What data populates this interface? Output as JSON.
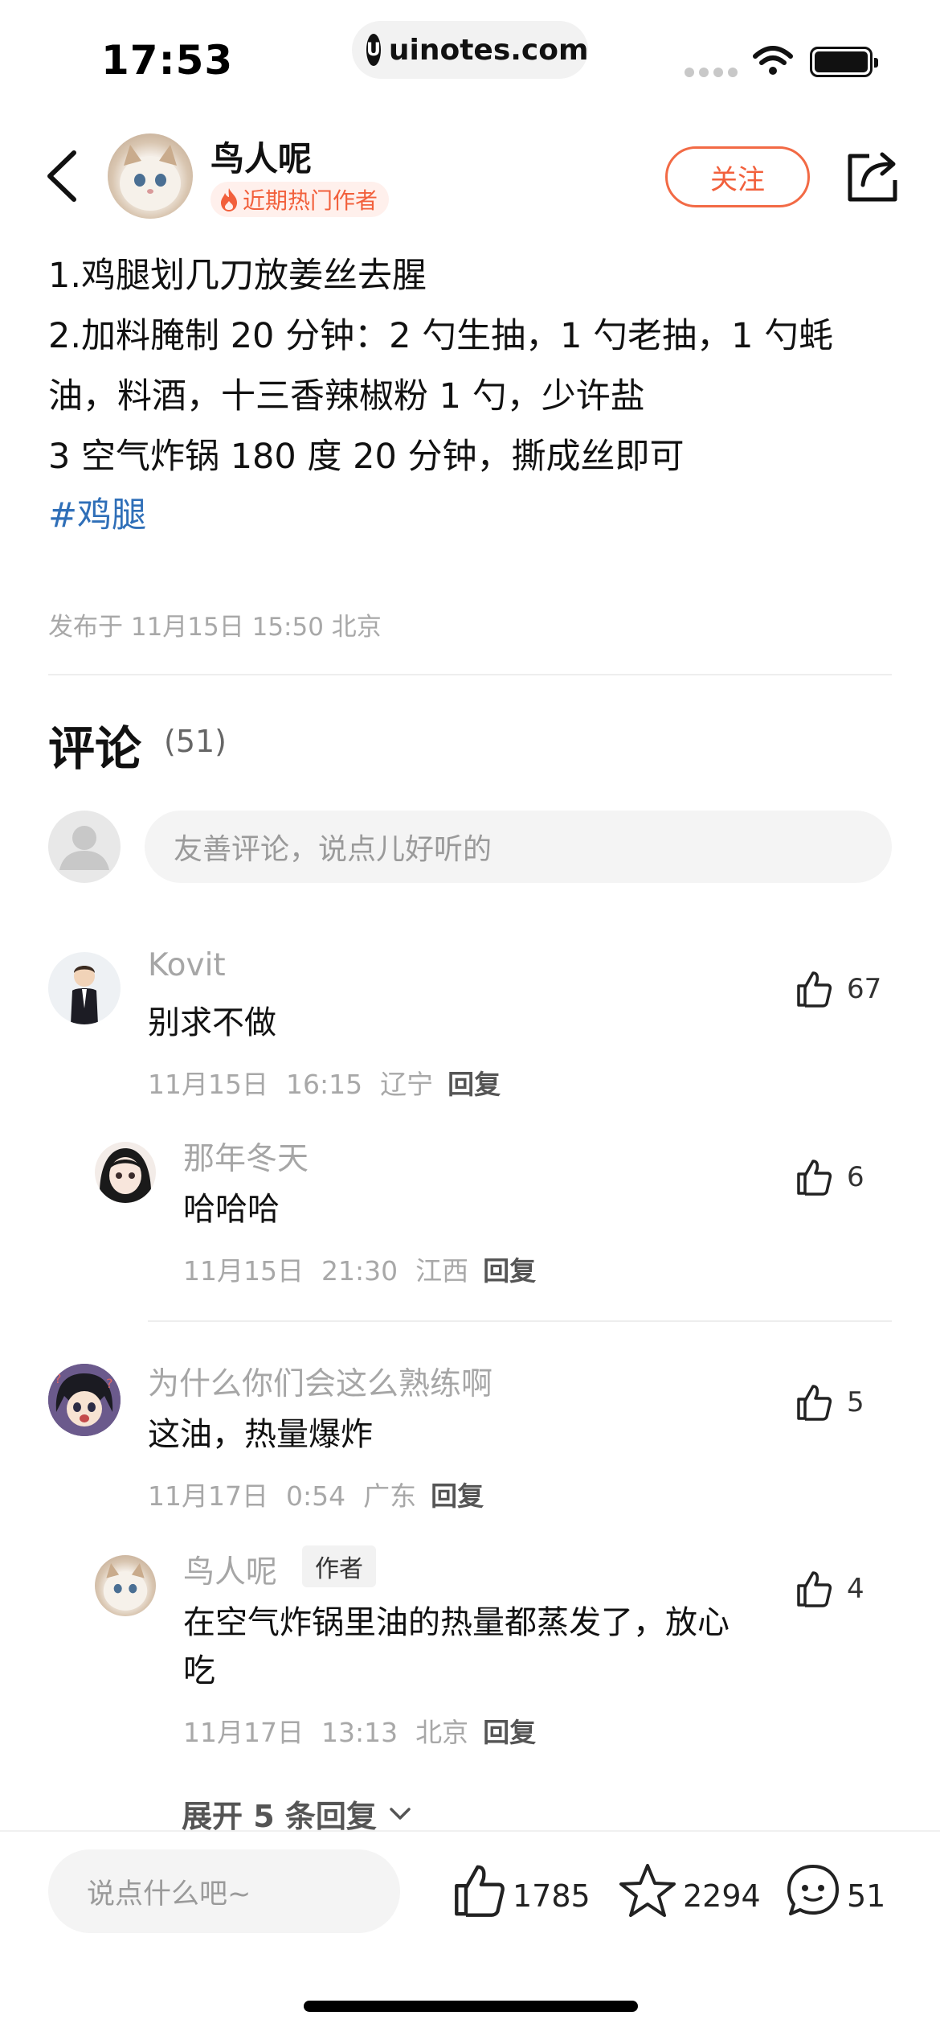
{
  "status_bar": {
    "time": "17:53",
    "url": "uinotes.com"
  },
  "header": {
    "author_name": "鸟人呢",
    "badge_text": "近期热门作者",
    "follow_label": "关注"
  },
  "post": {
    "lines": [
      "1.鸡腿划几刀放姜丝去腥",
      "2.加料腌制 20 分钟：2 勺生抽，1 勺老抽，1 勺蚝",
      "油，料酒，十三香辣椒粉 1 勺，少许盐",
      "3 空气炸锅 180 度 20 分钟，撕成丝即可"
    ],
    "hashtag": "#鸡腿",
    "meta": "发布于 11月15日 15:50  北京"
  },
  "comments_section": {
    "title": "评论",
    "count": "(51)",
    "input_placeholder": "友善评论，说点儿好听的"
  },
  "comments": [
    {
      "name": "Kovit",
      "text": "别求不做",
      "date": "11月15日",
      "time": "16:15",
      "location": "辽宁",
      "reply_label": "回复",
      "likes": "67"
    },
    {
      "name": "那年冬天",
      "text": "哈哈哈",
      "date": "11月15日",
      "time": "21:30",
      "location": "江西",
      "reply_label": "回复",
      "likes": "6"
    },
    {
      "name": "为什么你们会这么熟练啊",
      "text": "这油，热量爆炸",
      "date": "11月17日",
      "time": "0:54",
      "location": "广东",
      "reply_label": "回复",
      "likes": "5"
    },
    {
      "name": "鸟人呢",
      "author_tag": "作者",
      "text_line1": "在空气炸锅里油的热量都蒸发了，放心",
      "text_line2": "吃",
      "date": "11月17日",
      "time": "13:13",
      "location": "北京",
      "reply_label": "回复",
      "likes": "4"
    }
  ],
  "expand_label": "展开 5 条回复",
  "bottom_bar": {
    "input_placeholder": "说点什么吧~",
    "likes": "1785",
    "favorites": "2294",
    "comments": "51"
  },
  "colors": {
    "accent": "#f2603c",
    "link": "#2f6fb8",
    "muted": "#a8a8a8"
  }
}
